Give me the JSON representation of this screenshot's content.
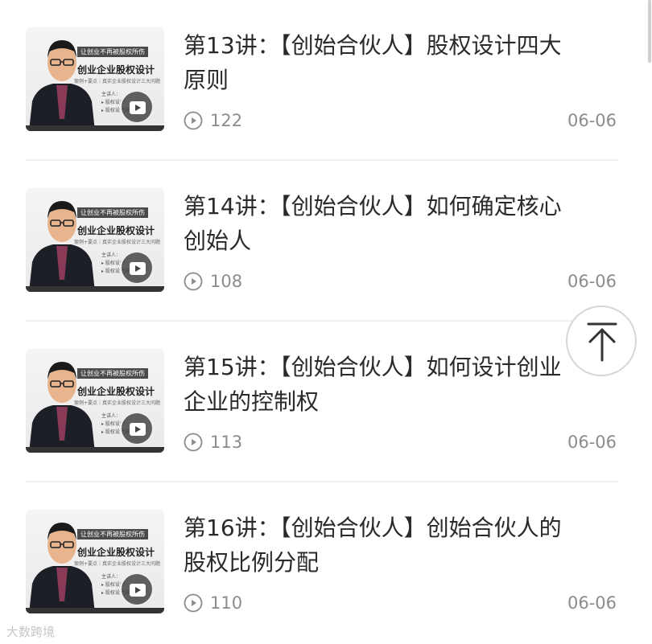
{
  "lectures": [
    {
      "title_line1": "第13讲：【创始合伙人】股权设计四大",
      "title_line2": "原则",
      "views": "122",
      "date": "06-06"
    },
    {
      "title_line1": "第14讲：【创始合伙人】如何确定核心",
      "title_line2": "创始人",
      "views": "108",
      "date": "06-06"
    },
    {
      "title_line1": "第15讲：【创始合伙人】如何设计创业",
      "title_line2": "企业的控制权",
      "views": "113",
      "date": "06-06"
    },
    {
      "title_line1": "第16讲：【创始合伙人】创始合伙人的",
      "title_line2": "股权比例分配",
      "views": "110",
      "date": "06-06"
    }
  ],
  "thumbnail": {
    "banner": "让创业不再被股权所伤",
    "title": "创业企业股权设计",
    "subtitle": "案例+要点｜真实企业股权设计三大问题",
    "lecturer": "主讲人：",
    "bullet1": "▸ 股权设计",
    "bullet2": "▸ 股权设计方案"
  },
  "watermark": "大数跨境",
  "icons": {
    "views": "play-circle-icon",
    "back_to_top": "arrow-up-icon",
    "thumbnail_play": "play-icon"
  },
  "colors": {
    "text": "#2a2a2a",
    "meta": "#8c8c8c",
    "divider": "#f0f0f0"
  }
}
